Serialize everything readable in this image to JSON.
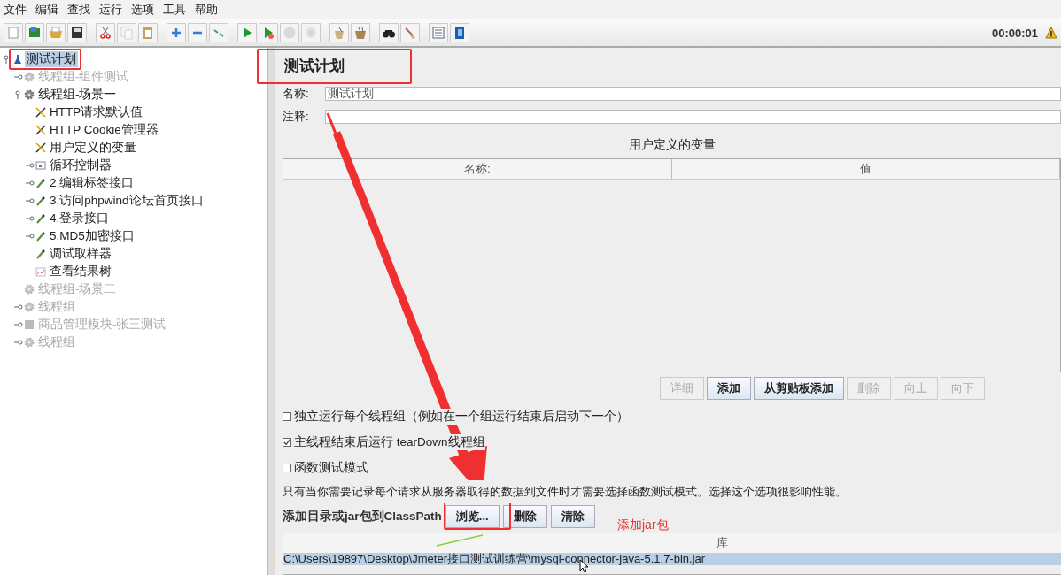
{
  "menu": [
    "文件",
    "编辑",
    "查找",
    "运行",
    "选项",
    "工具",
    "帮助"
  ],
  "toolbar": [
    {
      "kind": "new",
      "disabled": false
    },
    {
      "kind": "templates",
      "disabled": false
    },
    {
      "kind": "open",
      "disabled": false
    },
    {
      "kind": "save",
      "disabled": false
    },
    {
      "kind": "cut",
      "disabled": false
    },
    {
      "kind": "copy",
      "disabled": true
    },
    {
      "kind": "paste",
      "disabled": false
    },
    {
      "kind": "expand",
      "disabled": false
    },
    {
      "kind": "collapse",
      "disabled": false
    },
    {
      "kind": "toggle",
      "disabled": false
    },
    {
      "kind": "start",
      "disabled": false
    },
    {
      "kind": "start-no-pause",
      "disabled": false
    },
    {
      "kind": "stop",
      "disabled": true
    },
    {
      "kind": "shutdown",
      "disabled": true
    },
    {
      "kind": "clear",
      "disabled": false
    },
    {
      "kind": "clear-all",
      "disabled": false
    },
    {
      "kind": "search",
      "disabled": false
    },
    {
      "kind": "reset-search",
      "disabled": false
    },
    {
      "kind": "functions",
      "disabled": false
    },
    {
      "kind": "help",
      "disabled": false
    }
  ],
  "timer": "00:00:01",
  "tree": [
    {
      "label": "测试计划",
      "kind": "plan",
      "enabled": true,
      "selected": true,
      "expanded": true,
      "children": [
        {
          "label": "线程组-组件测试",
          "kind": "thread-group",
          "enabled": false,
          "selected": false,
          "expanded": false
        },
        {
          "label": "线程组-场景一",
          "kind": "thread-group",
          "enabled": true,
          "selected": false,
          "expanded": true,
          "children": [
            {
              "label": "HTTP请求默认值",
              "kind": "config",
              "enabled": true,
              "selected": false
            },
            {
              "label": "HTTP Cookie管理器",
              "kind": "config",
              "enabled": true,
              "selected": false
            },
            {
              "label": "用户定义的变量",
              "kind": "config",
              "enabled": true,
              "selected": false
            },
            {
              "label": "循环控制器",
              "kind": "controller",
              "enabled": true,
              "selected": false,
              "expanded": false
            },
            {
              "label": "2.编辑标签接口",
              "kind": "sampler",
              "enabled": true,
              "selected": false,
              "expanded": false
            },
            {
              "label": "3.访问phpwind论坛首页接口",
              "kind": "sampler",
              "enabled": true,
              "selected": false,
              "expanded": false
            },
            {
              "label": "4.登录接口",
              "kind": "sampler",
              "enabled": true,
              "selected": false,
              "expanded": false
            },
            {
              "label": "5.MD5加密接口",
              "kind": "sampler",
              "enabled": true,
              "selected": false,
              "expanded": false
            },
            {
              "label": "调试取样器",
              "kind": "sampler",
              "enabled": true,
              "selected": false
            },
            {
              "label": "查看结果树",
              "kind": "listener",
              "enabled": true,
              "selected": false
            }
          ]
        },
        {
          "label": "线程组-场景二",
          "kind": "thread-group",
          "enabled": false,
          "selected": false
        },
        {
          "label": "线程组",
          "kind": "thread-group",
          "enabled": false,
          "selected": false,
          "expanded": false
        },
        {
          "label": "商品管理模块-张三测试",
          "kind": "module",
          "enabled": false,
          "selected": false,
          "expanded": false
        },
        {
          "label": "线程组",
          "kind": "thread-group",
          "enabled": false,
          "selected": false,
          "expanded": false
        }
      ]
    }
  ],
  "panel": {
    "title": "测试计划",
    "name_label": "名称:",
    "name_value": "测试计划",
    "comment_label": "注释:",
    "variables": {
      "title": "用户定义的变量",
      "columns": [
        "名称:",
        "值"
      ]
    },
    "variable_buttons": [
      {
        "label": "详细",
        "disabled": true
      },
      {
        "label": "添加",
        "disabled": false
      },
      {
        "label": "从剪贴板添加",
        "disabled": false
      },
      {
        "label": "删除",
        "disabled": true
      },
      {
        "label": "向上",
        "disabled": true
      },
      {
        "label": "向下",
        "disabled": true
      }
    ],
    "options": [
      {
        "label": "独立运行每个线程组（例如在一个组运行结束后启动下一个）",
        "checked": false
      },
      {
        "label": "主线程结束后运行 tearDown线程组",
        "checked": true
      },
      {
        "label": "函数测试模式",
        "checked": false
      }
    ],
    "note": "只有当你需要记录每个请求从服务器取得的数据到文件时才需要选择函数测试模式。选择这个选项很影响性能。",
    "classpath_label": "添加目录或jar包到ClassPath",
    "classpath_buttons": [
      "浏览...",
      "删除",
      "清除"
    ],
    "library": {
      "column": "库",
      "rows": [
        {
          "path": "C:\\Users\\19897\\Desktop\\Jmeter接口测试训练营\\mysql-connector-java-5.1.7-bin.jar",
          "selected": true
        }
      ]
    }
  },
  "annotation": "添加jar包"
}
